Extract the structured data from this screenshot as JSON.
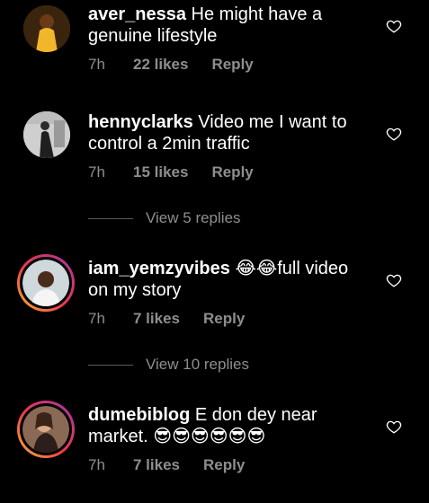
{
  "comments": [
    {
      "username": "aver_nessa",
      "text": "He might have a genuine lifestyle",
      "time": "7h",
      "likes": "22 likes",
      "reply": "Reply"
    },
    {
      "username": "hennyclarks",
      "text": "Video me I want to control a 2min traffic",
      "time": "7h",
      "likes": "15 likes",
      "reply": "Reply",
      "view_replies": "View 5 replies"
    },
    {
      "username": "iam_yemzyvibes",
      "text": "😂😂full video on my story",
      "time": "7h",
      "likes": "7 likes",
      "reply": "Reply",
      "view_replies": "View 10 replies"
    },
    {
      "username": "dumebiblog",
      "text": "E don dey near market. 😎😎😎😎😎😎",
      "time": "7h",
      "likes": "7 likes",
      "reply": "Reply"
    }
  ],
  "icons": {
    "like": "heart-outline-icon"
  },
  "colors": {
    "background": "#000000",
    "text": "#ffffff",
    "meta": "#8e8e8e"
  }
}
